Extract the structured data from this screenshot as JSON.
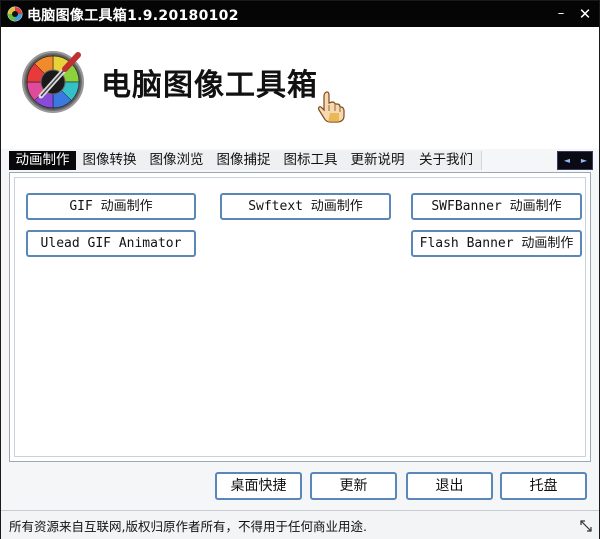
{
  "window": {
    "title": "电脑图像工具箱1.9.20180102",
    "minimize_glyph": "–",
    "close_glyph": "✕"
  },
  "header": {
    "app_name": "电脑图像工具箱",
    "logo_icon": "color-wheel-eyedropper-icon",
    "cursor_icon": "pointing-hand-icon"
  },
  "tabs": [
    {
      "label": "动画制作",
      "active": true
    },
    {
      "label": "图像转换",
      "active": false
    },
    {
      "label": "图像浏览",
      "active": false
    },
    {
      "label": "图像捕捉",
      "active": false
    },
    {
      "label": "图标工具",
      "active": false
    },
    {
      "label": "更新说明",
      "active": false
    },
    {
      "label": "关于我们",
      "active": false
    }
  ],
  "tab_scroll": {
    "left_icon": "◄",
    "right_icon": "►"
  },
  "tools": [
    {
      "label": "GIF 动画制作"
    },
    {
      "label": "Swftext 动画制作"
    },
    {
      "label": "SWFBanner 动画制作"
    },
    {
      "label": "Ulead GIF Animator"
    },
    {
      "label": "Flash Banner 动画制作"
    }
  ],
  "bottom_buttons": [
    {
      "label": "桌面快捷"
    },
    {
      "label": "更新"
    },
    {
      "label": "退出"
    },
    {
      "label": "托盘"
    }
  ],
  "status": {
    "text": "所有资源来自互联网,版权归原作者所有，不得用于任何商业用途."
  },
  "colors": {
    "titlebar_bg": "#050505",
    "active_tab_bg": "#08080a",
    "button_border": "#5a86b8",
    "panel_border": "#9aa7b4"
  }
}
